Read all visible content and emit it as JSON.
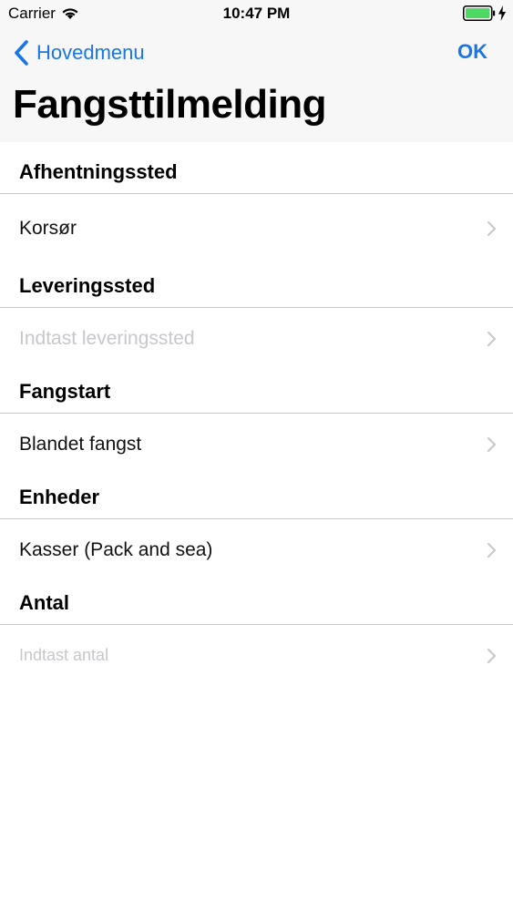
{
  "status_bar": {
    "carrier": "Carrier",
    "time": "10:47 PM",
    "battery_color": "#4cd964"
  },
  "nav": {
    "back_label": "Hovedmenu",
    "ok_label": "OK",
    "title": "Fangsttilmelding",
    "accent_color": "#1a76e6"
  },
  "form": {
    "sections": [
      {
        "header": "Afhentningssted",
        "value": "Korsør",
        "is_placeholder": false
      },
      {
        "header": "Leveringssted",
        "value": "Indtast leveringssted",
        "is_placeholder": true
      },
      {
        "header": "Fangstart",
        "value": "Blandet fangst",
        "is_placeholder": false
      },
      {
        "header": "Enheder",
        "value": "Kasser (Pack and sea)",
        "is_placeholder": false
      },
      {
        "header": "Antal",
        "value": "Indtast antal",
        "is_placeholder": true
      }
    ]
  },
  "icons": {
    "status": [
      "wifi-icon",
      "battery-icon",
      "charging-bolt-icon"
    ],
    "navigation": [
      "back-chevron-icon"
    ],
    "rows": [
      "chevron-right-icon"
    ]
  }
}
